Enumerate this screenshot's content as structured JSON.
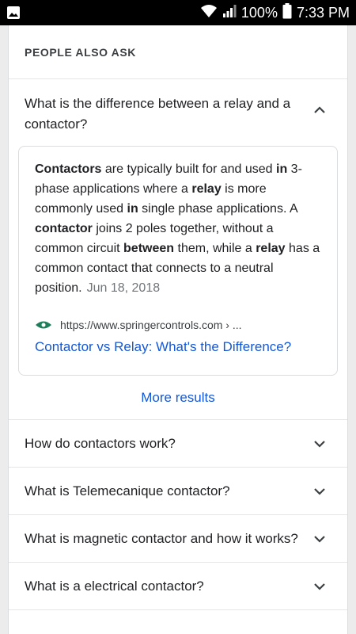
{
  "status_bar": {
    "battery": "100%",
    "time": "7:33 PM"
  },
  "paa": {
    "header": "PEOPLE ALSO ASK",
    "expanded_question": "What is the difference between a relay and a contactor?",
    "answer": {
      "segments": [
        {
          "t": "Contactors",
          "b": true
        },
        {
          "t": " are typically built for and used ",
          "b": false
        },
        {
          "t": "in",
          "b": true
        },
        {
          "t": " 3-phase applications where a ",
          "b": false
        },
        {
          "t": "relay",
          "b": true
        },
        {
          "t": " is more commonly used ",
          "b": false
        },
        {
          "t": "in",
          "b": true
        },
        {
          "t": " single phase applications. A ",
          "b": false
        },
        {
          "t": "contactor",
          "b": true
        },
        {
          "t": " joins 2 poles together, without a common circuit ",
          "b": false
        },
        {
          "t": "between",
          "b": true
        },
        {
          "t": " them, while a ",
          "b": false
        },
        {
          "t": "relay",
          "b": true
        },
        {
          "t": " has a common contact that connects to a neutral position.",
          "b": false
        }
      ],
      "date": "Jun 18, 2018",
      "source_url": "https://www.springercontrols.com › ...",
      "link_title": "Contactor vs Relay: What's the Difference?"
    },
    "more_results": "More results",
    "questions": [
      "How do contactors work?",
      "What is Telemecanique contactor?",
      "What is magnetic contactor and how it works?",
      "What is a electrical contactor?"
    ]
  }
}
